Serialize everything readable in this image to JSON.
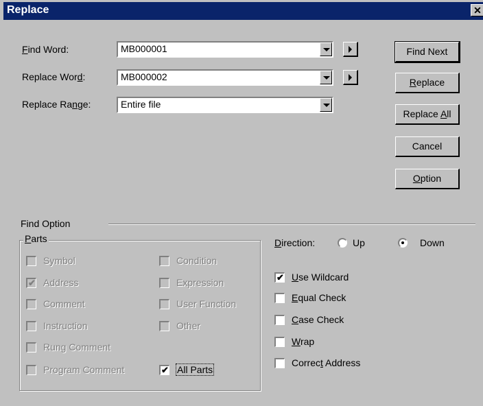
{
  "window": {
    "title": "Replace",
    "close_glyph": "✕"
  },
  "fields": {
    "find_word": {
      "label": "Find Word:",
      "value": "MB000001"
    },
    "replace_word": {
      "label": "Replace Word:",
      "value": "MB000002"
    },
    "replace_range": {
      "label": "Replace Range:",
      "value": "Entire file"
    }
  },
  "buttons": {
    "find_next": "Find Next",
    "replace": "Replace",
    "replace_all": "Replace All",
    "cancel": "Cancel",
    "option": "Option"
  },
  "find_option": {
    "title": "Find Option",
    "parts": {
      "title": "Parts",
      "items": [
        {
          "label": "Symbol",
          "checked": false,
          "enabled": false
        },
        {
          "label": "Condition",
          "checked": false,
          "enabled": false
        },
        {
          "label": "Address",
          "checked": true,
          "enabled": false
        },
        {
          "label": "Expression",
          "checked": false,
          "enabled": false
        },
        {
          "label": "Comment",
          "checked": false,
          "enabled": false
        },
        {
          "label": "User Function",
          "checked": false,
          "enabled": false
        },
        {
          "label": "Instruction",
          "checked": false,
          "enabled": false
        },
        {
          "label": "Other",
          "checked": false,
          "enabled": false
        },
        {
          "label": "Rung Comment",
          "checked": false,
          "enabled": false
        },
        {
          "label": "Program Comment",
          "checked": false,
          "enabled": false
        },
        {
          "label": "All Parts",
          "checked": true,
          "enabled": true
        }
      ]
    },
    "direction": {
      "label": "Direction:",
      "up": "Up",
      "down": "Down",
      "selected": "Down"
    },
    "options": [
      {
        "label": "Use Wildcard",
        "checked": true
      },
      {
        "label": "Equal Check",
        "checked": false
      },
      {
        "label": "Case Check",
        "checked": false
      },
      {
        "label": "Wrap",
        "checked": false
      },
      {
        "label": "Correct Address",
        "checked": false
      }
    ]
  }
}
